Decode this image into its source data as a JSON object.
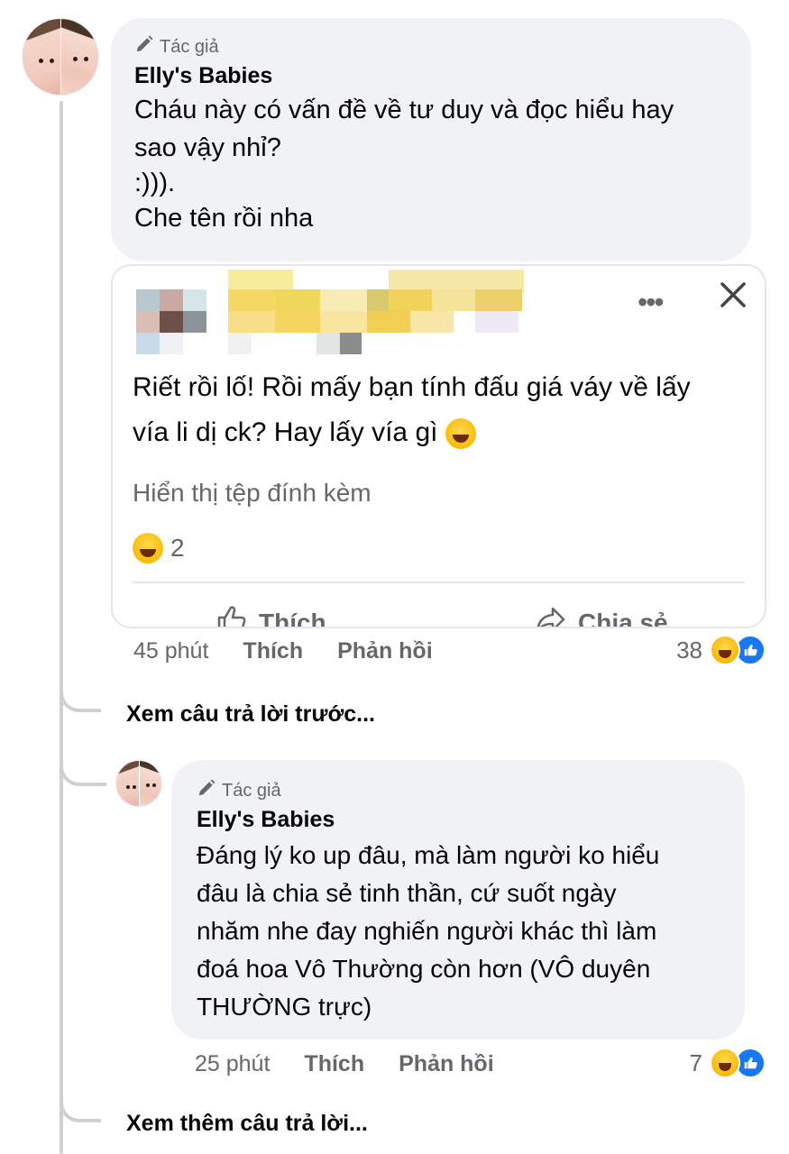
{
  "comment1": {
    "author_badge": "Tác giả",
    "author_name": "Elly's Babies",
    "lines": [
      "Cháu này có vấn đề về tư duy và đọc hiểu hay",
      "sao vậy nhỉ?",
      ":))).",
      "Che tên rồi nha"
    ],
    "shared_card": {
      "menu": "•••",
      "text_lines": [
        "Riết rồi lố! Rồi mấy bạn tính đấu giá váy về lấy",
        "vía li dị ck? Hay lấy vía gì"
      ],
      "attachment": "Hiển thị tệp đính kèm",
      "reaction_count": "2",
      "like_label": "Thích",
      "share_label": "Chia sẻ"
    },
    "time": "45 phút",
    "like": "Thích",
    "reply": "Phản hồi",
    "reaction_count": "38"
  },
  "view_previous": "Xem câu trả lời trước...",
  "comment2": {
    "author_badge": "Tác giả",
    "author_name": "Elly's Babies",
    "lines": [
      "Đáng lý ko up đâu, mà làm người ko hiểu",
      "đâu là chia sẻ tinh thần, cứ suốt ngày",
      "nhăm nhe đay nghiến người khác thì làm",
      "đoá hoa Vô Thường còn hơn (VÔ duyên",
      "THƯỜNG trực)"
    ],
    "time": "25 phút",
    "like": "Thích",
    "reply": "Phản hồi",
    "reaction_count": "7"
  },
  "view_more": "Xem thêm câu trả lời...",
  "icons": {
    "author": "pencil-icon",
    "menu": "more-dots-icon",
    "close": "close-icon",
    "like": "thumbs-up-icon",
    "share": "share-arrow-icon",
    "reaction_laugh": "laugh-emoji-icon",
    "reaction_like": "like-reaction-icon"
  },
  "colors": {
    "bubble": "#f0f2f5",
    "secondary_text": "#65676b",
    "thread_line": "#ced0d4",
    "like_blue": "#1877f2"
  }
}
